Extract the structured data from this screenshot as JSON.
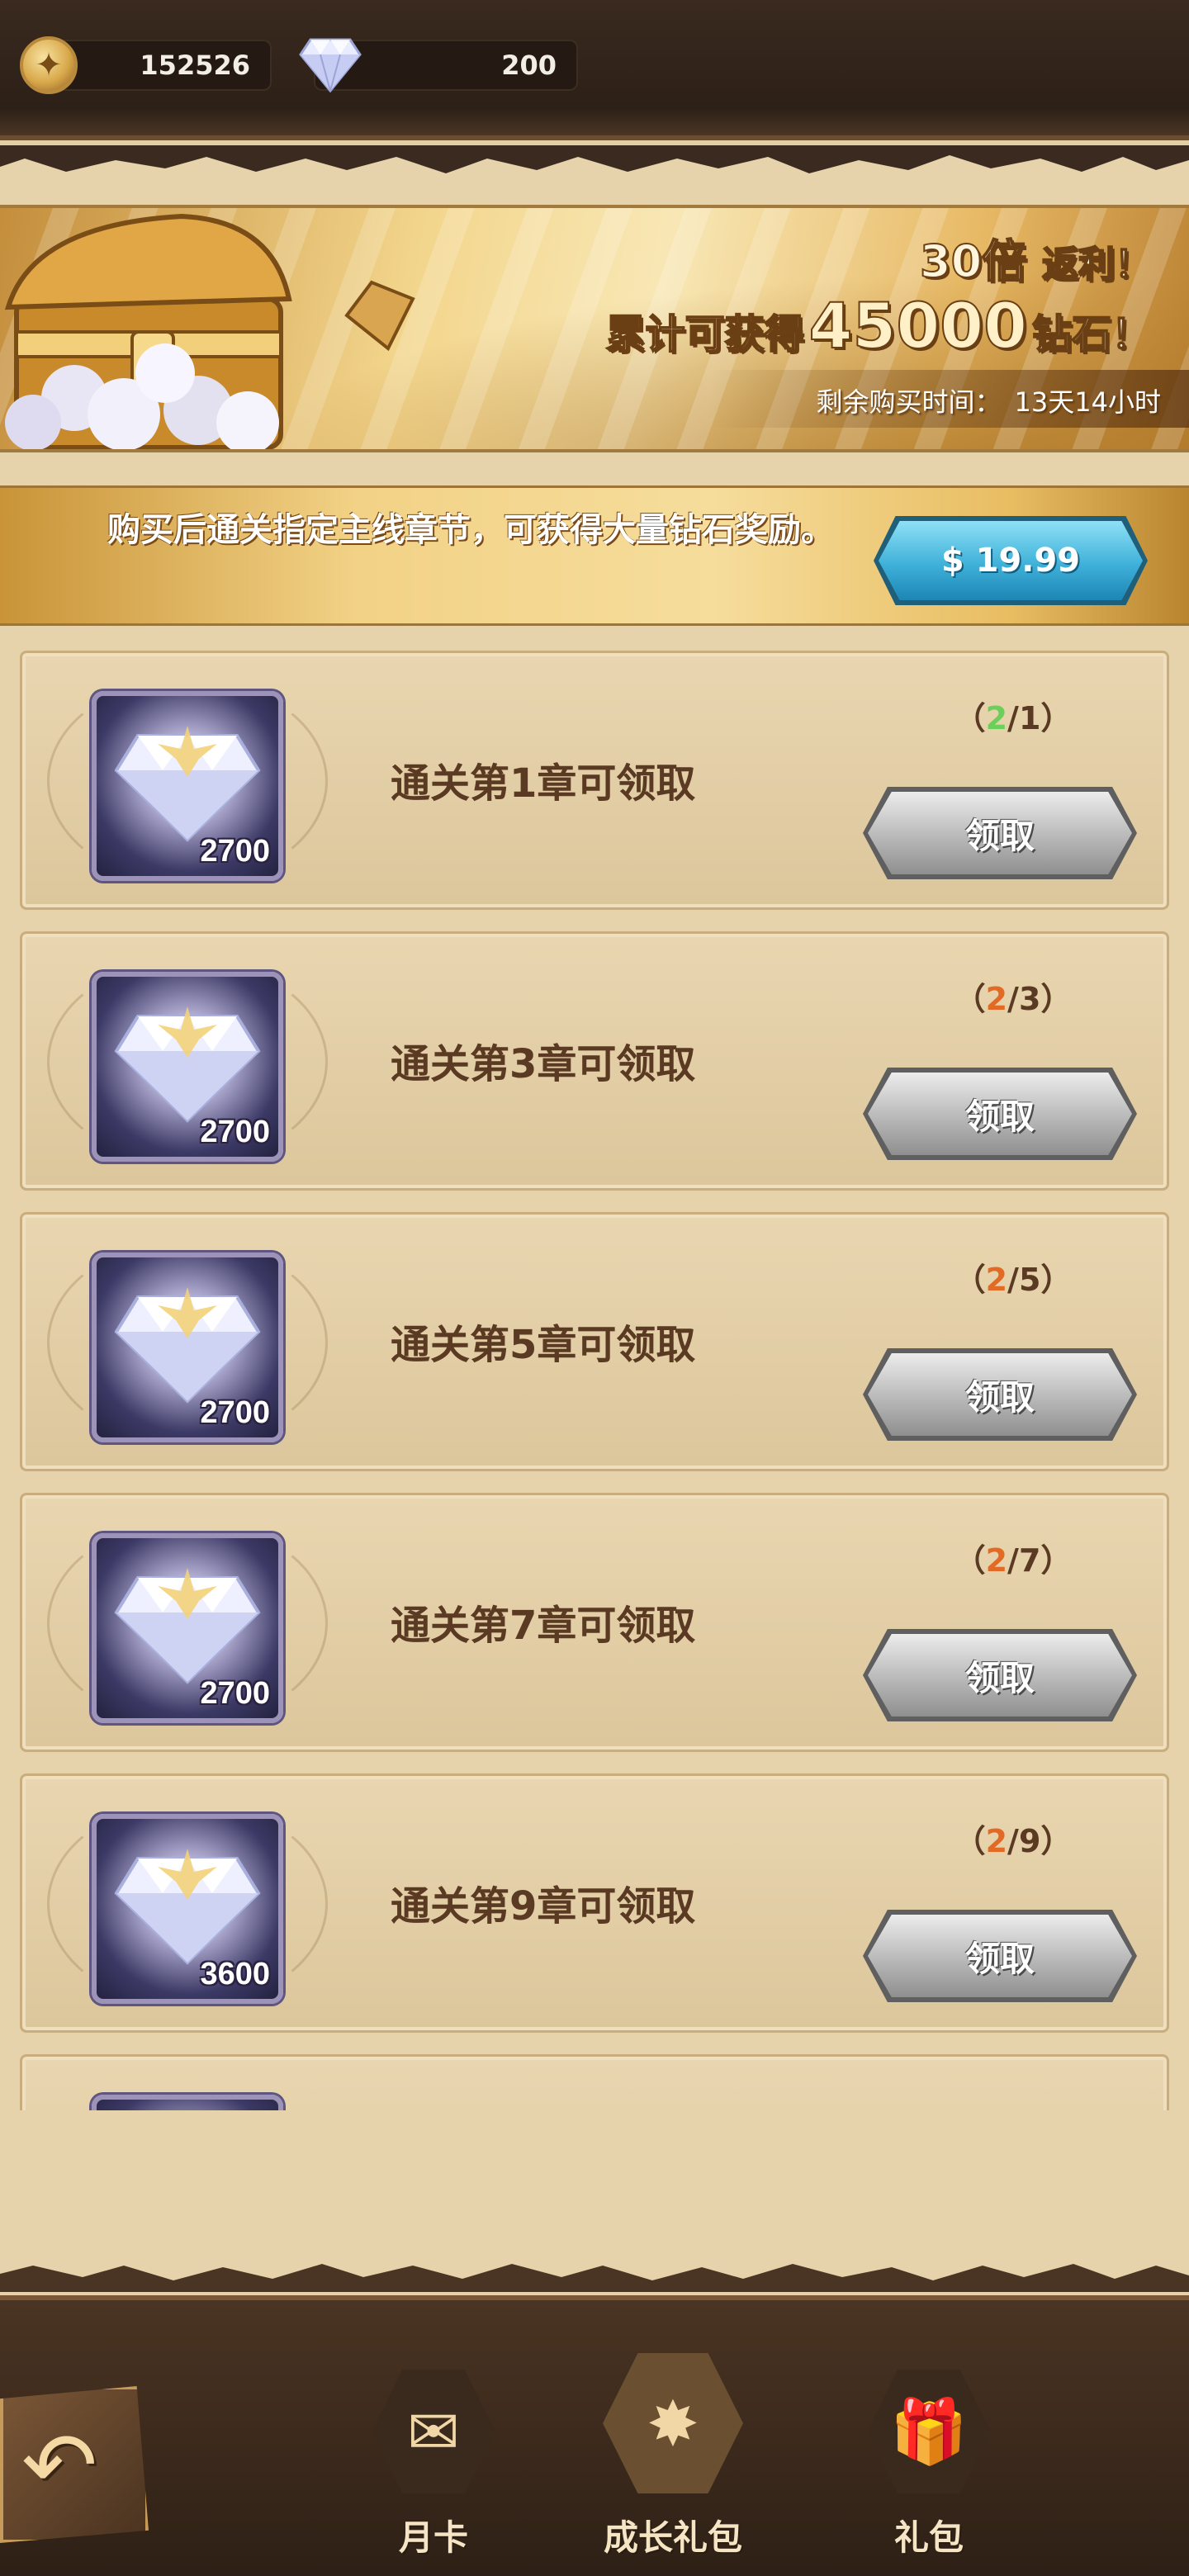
{
  "resources": {
    "gold": "152526",
    "gems": "200",
    "gold_icon": "gold-coin-icon",
    "gem_icon": "diamond-icon"
  },
  "banner": {
    "multiplier": "30倍",
    "rebate": "返利！",
    "cumulative_prefix": "累计可获得",
    "cumulative_amount": "45000",
    "cumulative_suffix": "钻石！",
    "timer_label": "剩余购买时间：",
    "timer_value": "13天14小时"
  },
  "purchase": {
    "description": "购买后通关指定主线章节，可获得大量钻石奖励。",
    "price": "$ 19.99"
  },
  "rewards": [
    {
      "amount": "2700",
      "title": "通关第1章可领取",
      "current": "2",
      "required": "1",
      "met": true,
      "button": "领取"
    },
    {
      "amount": "2700",
      "title": "通关第3章可领取",
      "current": "2",
      "required": "3",
      "met": false,
      "button": "领取"
    },
    {
      "amount": "2700",
      "title": "通关第5章可领取",
      "current": "2",
      "required": "5",
      "met": false,
      "button": "领取"
    },
    {
      "amount": "2700",
      "title": "通关第7章可领取",
      "current": "2",
      "required": "7",
      "met": false,
      "button": "领取"
    },
    {
      "amount": "3600",
      "title": "通关第9章可领取",
      "current": "2",
      "required": "9",
      "met": false,
      "button": "领取"
    }
  ],
  "nav": {
    "back_icon": "back-arrow-icon",
    "tabs": [
      {
        "label": "月卡",
        "icon": "letter-icon",
        "active": false
      },
      {
        "label": "成长礼包",
        "icon": "star-bag-icon",
        "active": true
      },
      {
        "label": "礼包",
        "icon": "gift-box-icon",
        "active": false
      }
    ]
  },
  "colors": {
    "progress_incomplete": "#e36a25",
    "progress_complete": "#6ad05a",
    "price_button": "#3fb1d9",
    "claim_button": "#bdbdbd"
  }
}
